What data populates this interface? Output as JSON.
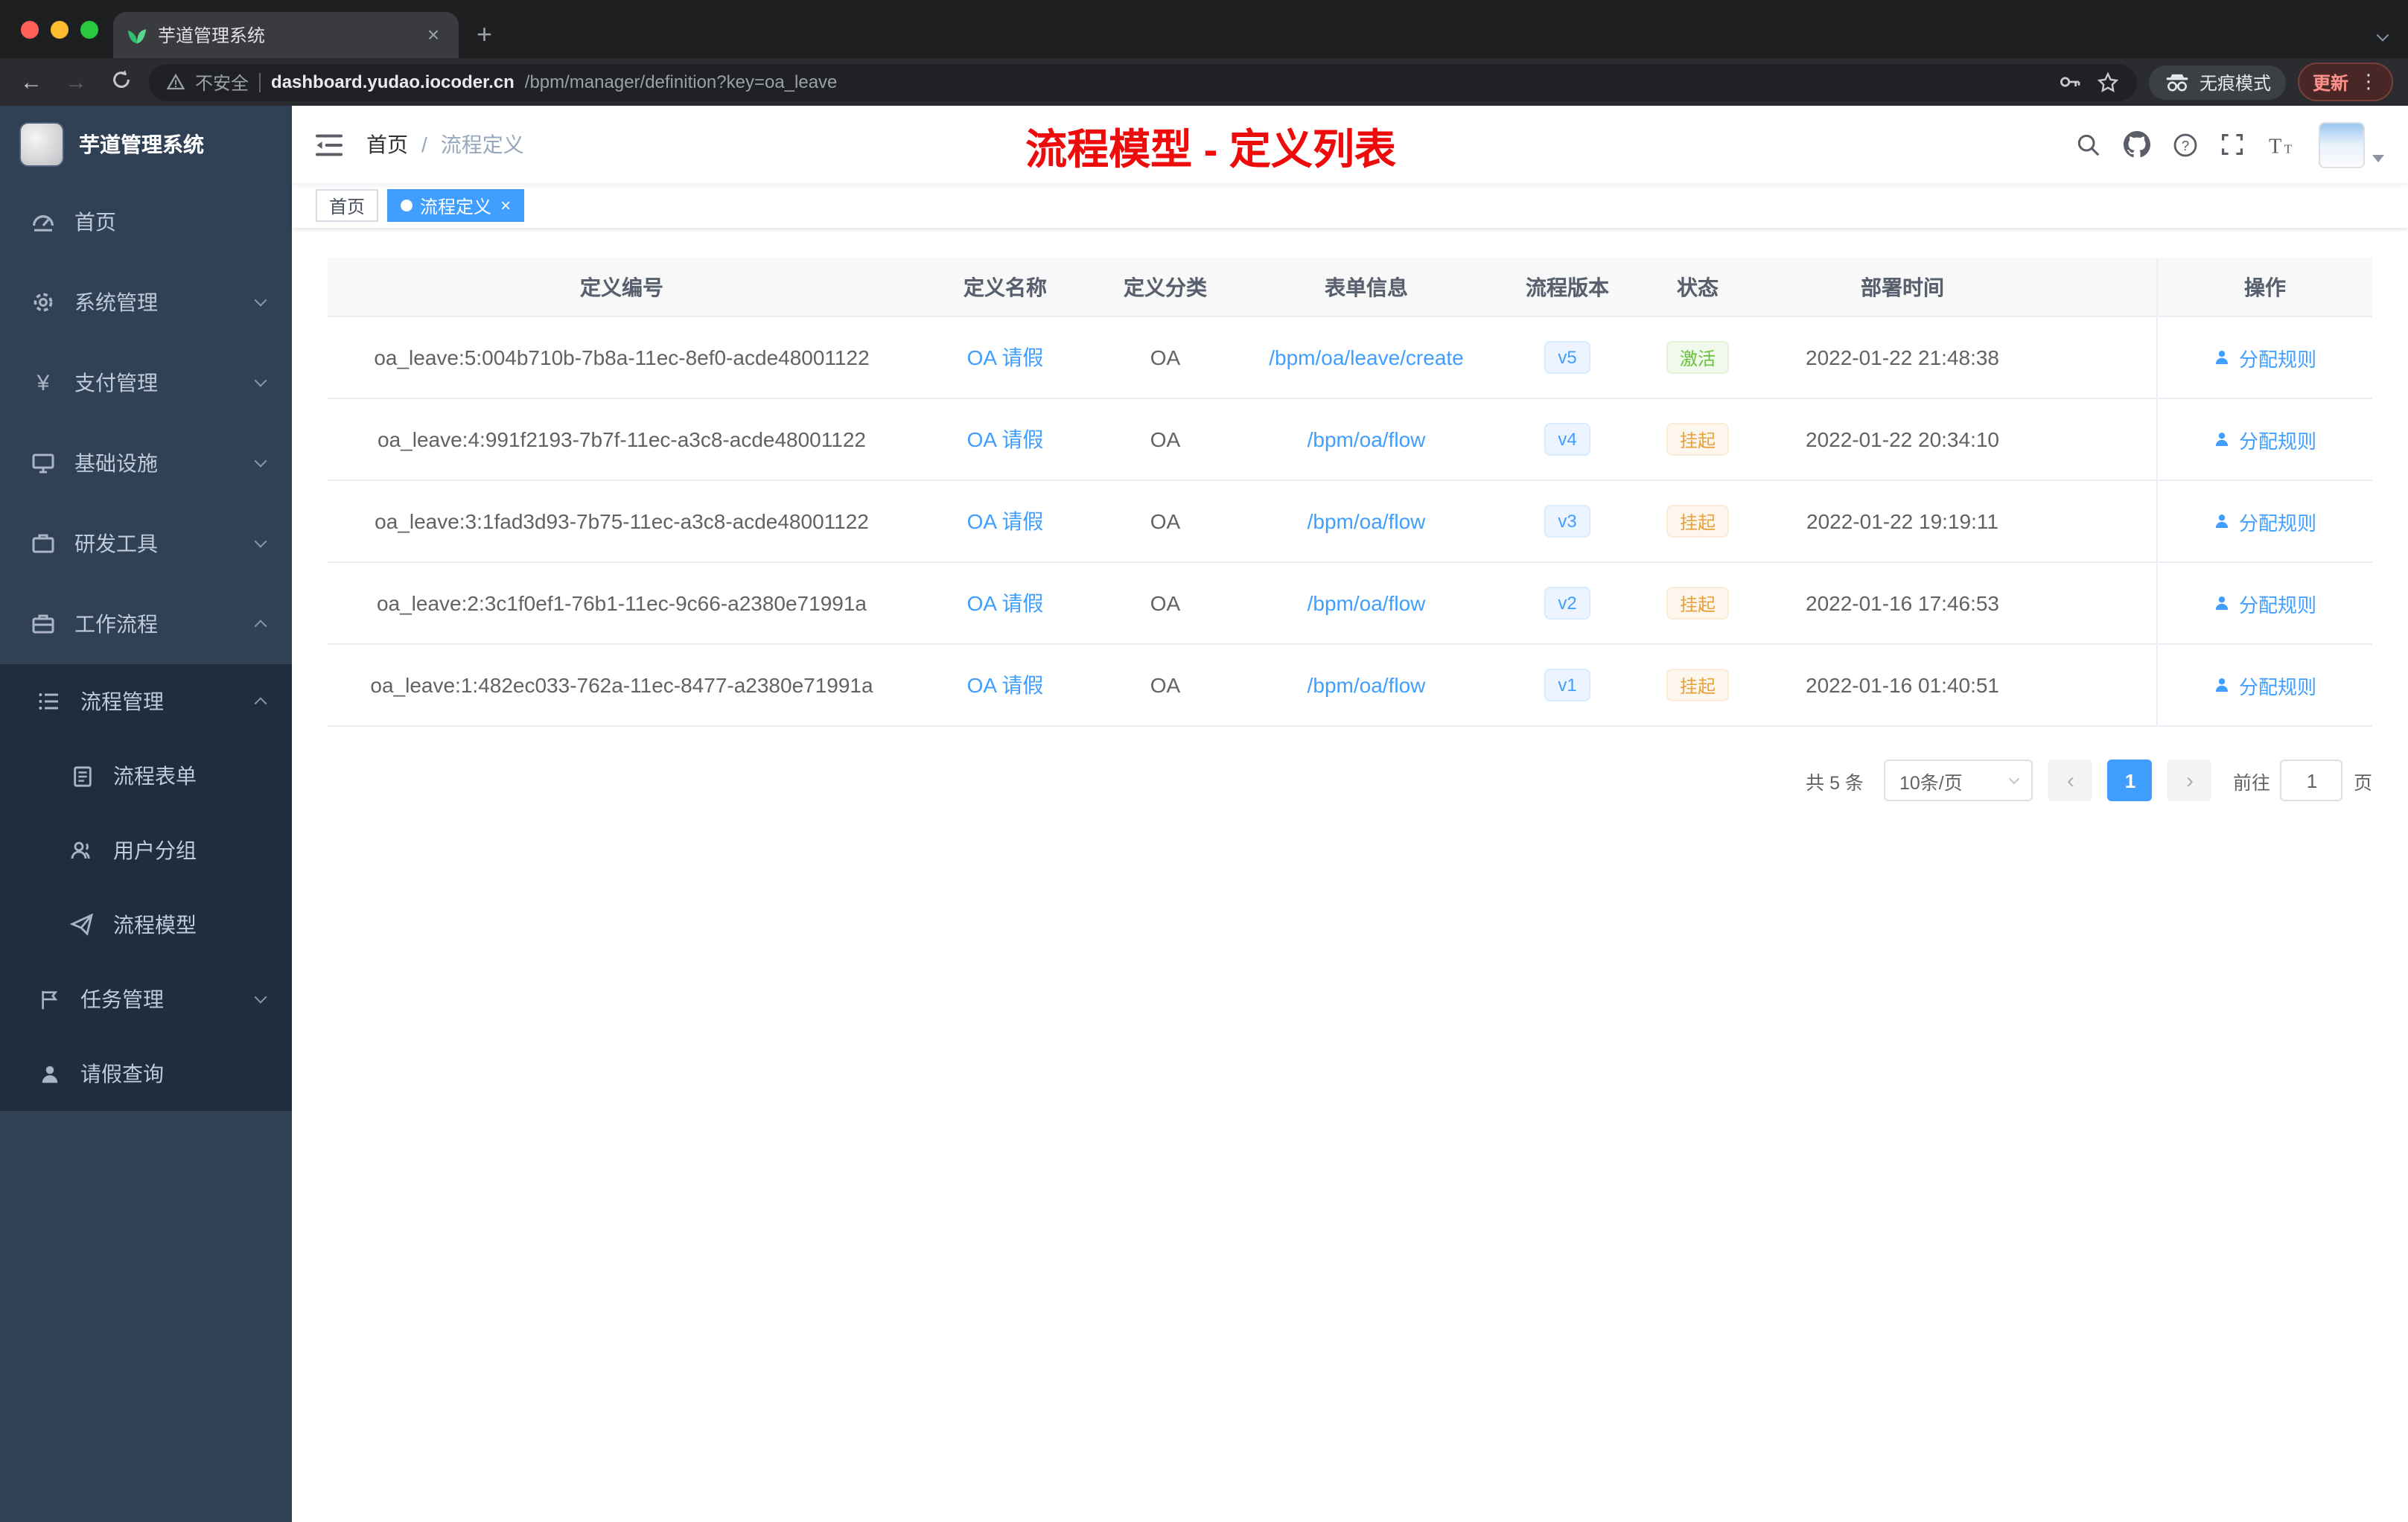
{
  "browser": {
    "tab_title": "芋道管理系统",
    "security_label": "不安全",
    "url_host": "dashboard.yudao.iocoder.cn",
    "url_path": "/bpm/manager/definition?key=oa_leave",
    "incognito_label": "无痕模式",
    "update_label": "更新"
  },
  "sidebar": {
    "logo_title": "芋道管理系统",
    "items": [
      {
        "label": "首页"
      },
      {
        "label": "系统管理"
      },
      {
        "label": "支付管理"
      },
      {
        "label": "基础设施"
      },
      {
        "label": "研发工具"
      },
      {
        "label": "工作流程"
      },
      {
        "label": "流程管理"
      },
      {
        "label": "流程表单"
      },
      {
        "label": "用户分组"
      },
      {
        "label": "流程模型"
      },
      {
        "label": "任务管理"
      },
      {
        "label": "请假查询"
      }
    ]
  },
  "header": {
    "breadcrumb_home": "首页",
    "breadcrumb_sep": "/",
    "breadcrumb_current": "流程定义",
    "annotation": "流程模型 - 定义列表"
  },
  "tags": {
    "home": "首页",
    "current": "流程定义"
  },
  "table": {
    "columns": {
      "id": "定义编号",
      "name": "定义名称",
      "category": "定义分类",
      "form": "表单信息",
      "version": "流程版本",
      "status": "状态",
      "deploy_time": "部署时间",
      "actions": "操作"
    },
    "rows": [
      {
        "id": "oa_leave:5:004b710b-7b8a-11ec-8ef0-acde48001122",
        "name": "OA 请假",
        "category": "OA",
        "form": "/bpm/oa/leave/create",
        "version": "v5",
        "status": "激活",
        "deploy_time": "2022-01-22 21:48:38",
        "action": "分配规则"
      },
      {
        "id": "oa_leave:4:991f2193-7b7f-11ec-a3c8-acde48001122",
        "name": "OA 请假",
        "category": "OA",
        "form": "/bpm/oa/flow",
        "version": "v4",
        "status": "挂起",
        "deploy_time": "2022-01-22 20:34:10",
        "action": "分配规则"
      },
      {
        "id": "oa_leave:3:1fad3d93-7b75-11ec-a3c8-acde48001122",
        "name": "OA 请假",
        "category": "OA",
        "form": "/bpm/oa/flow",
        "version": "v3",
        "status": "挂起",
        "deploy_time": "2022-01-22 19:19:11",
        "action": "分配规则"
      },
      {
        "id": "oa_leave:2:3c1f0ef1-76b1-11ec-9c66-a2380e71991a",
        "name": "OA 请假",
        "category": "OA",
        "form": "/bpm/oa/flow",
        "version": "v2",
        "status": "挂起",
        "deploy_time": "2022-01-16 17:46:53",
        "action": "分配规则"
      },
      {
        "id": "oa_leave:1:482ec033-762a-11ec-8477-a2380e71991a",
        "name": "OA 请假",
        "category": "OA",
        "form": "/bpm/oa/flow",
        "version": "v1",
        "status": "挂起",
        "deploy_time": "2022-01-16 01:40:51",
        "action": "分配规则"
      }
    ]
  },
  "pagination": {
    "total": "共 5 条",
    "page_size": "10条/页",
    "current_page": "1",
    "goto_label": "前往",
    "goto_value": "1",
    "goto_unit": "页"
  },
  "colors": {
    "accent": "#409eff",
    "success": "#67c23a",
    "warning": "#e6a23c",
    "annotation_red": "#ee0b0b",
    "sidebar_bg": "#304156",
    "submenu_bg": "#1f2d3d"
  }
}
